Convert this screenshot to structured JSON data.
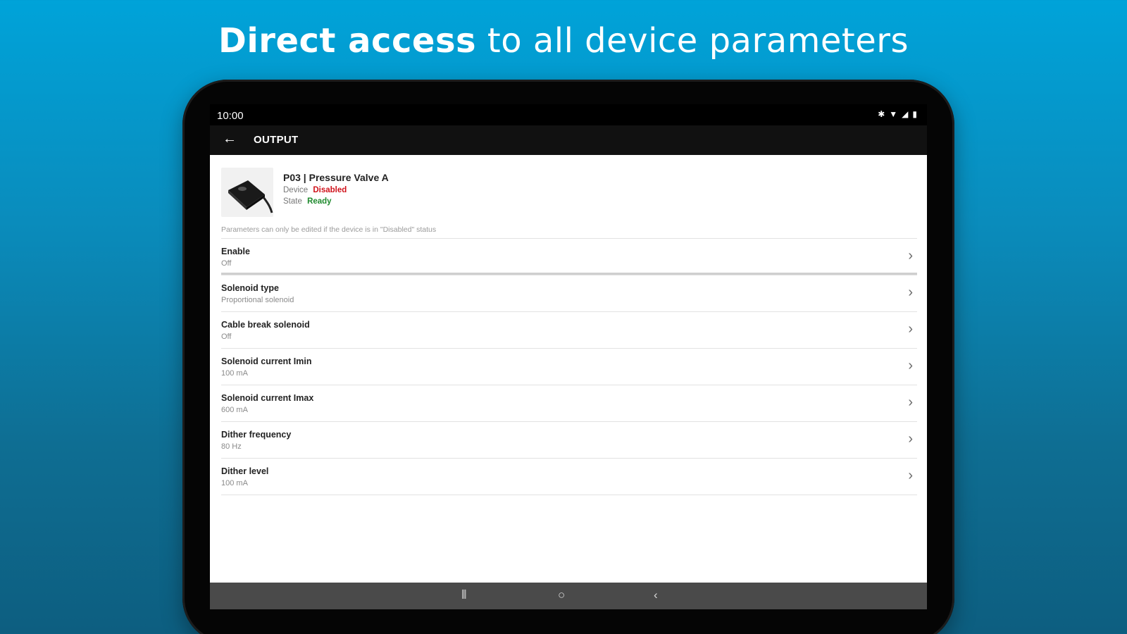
{
  "headline": {
    "bold": "Direct access",
    "rest": "to all device parameters"
  },
  "status_bar": {
    "time": "10:00"
  },
  "app_bar": {
    "title": "OUTPUT"
  },
  "device": {
    "name": "P03 | Pressure Valve A",
    "device_label": "Device",
    "device_value": "Disabled",
    "state_label": "State",
    "state_value": "Ready"
  },
  "note": "Parameters can only be edited if the device is in \"Disabled\" status",
  "parameters": [
    {
      "label": "Enable",
      "value": "Off"
    },
    {
      "label": "Solenoid type",
      "value": "Proportional solenoid"
    },
    {
      "label": "Cable break solenoid",
      "value": "Off"
    },
    {
      "label": "Solenoid current Imin",
      "value": "100 mA"
    },
    {
      "label": "Solenoid current Imax",
      "value": "600 mA"
    },
    {
      "label": "Dither frequency",
      "value": "80 Hz"
    },
    {
      "label": "Dither level",
      "value": "100 mA"
    }
  ],
  "colors": {
    "disabled": "#d0121b",
    "ready": "#1f8a2e",
    "background_top": "#00a3d9",
    "background_bottom": "#0d5e80"
  },
  "icons": {
    "back": "arrow-left-icon",
    "chevron": "chevron-right-icon",
    "recents": "recents-icon",
    "home": "home-icon",
    "nav_back": "nav-back-icon"
  }
}
